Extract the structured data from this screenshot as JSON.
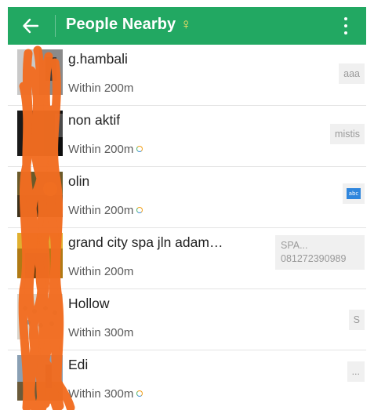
{
  "header": {
    "title": "People Nearby",
    "gender_symbol": "♀",
    "back_icon": "arrow-left-icon",
    "menu_icon": "more-vertical-icon",
    "color": "#22a862"
  },
  "people": [
    {
      "name": "g.hambali",
      "distance": "Within 200m",
      "signature": "aaa"
    },
    {
      "name": "non aktif",
      "distance": "Within 200m",
      "signature": "mistis"
    },
    {
      "name": "olin",
      "distance": "Within 200m",
      "signature": "abc"
    },
    {
      "name": "grand city spa jln adam…",
      "distance": "Within 200m",
      "signature_line1": "SPA...",
      "signature_line2": "081272390989"
    },
    {
      "name": "Hollow",
      "distance": "Within 300m",
      "signature": "S"
    },
    {
      "name": "Edi",
      "distance": "Within 300m",
      "signature": "..."
    }
  ]
}
